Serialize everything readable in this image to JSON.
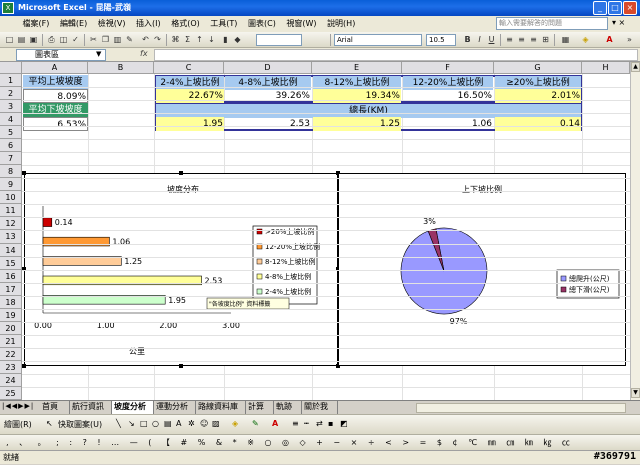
{
  "window": {
    "title": "Microsoft Excel - 昆陽-武嶺",
    "app_icon_label": "X",
    "min": "_",
    "max": "□",
    "close": "×"
  },
  "menu": {
    "items": [
      "檔案(F)",
      "編輯(E)",
      "檢視(V)",
      "插入(I)",
      "格式(O)",
      "工具(T)",
      "圖表(C)",
      "視窗(W)",
      "說明(H)"
    ],
    "help_placeholder": "輸入需要解答的問題"
  },
  "toolbar": {
    "font_name": "Arial",
    "font_size": "10.5",
    "zoom": ""
  },
  "formula": {
    "name_box": "圖表區",
    "fx": "fx",
    "value": ""
  },
  "columns": [
    "A",
    "B",
    "C",
    "D",
    "E",
    "F",
    "G",
    "H"
  ],
  "rows": [
    "1",
    "2",
    "3",
    "4",
    "5",
    "6",
    "7",
    "8",
    "9",
    "10",
    "11",
    "12",
    "13",
    "14",
    "15",
    "16",
    "17",
    "18",
    "19",
    "20",
    "21",
    "22",
    "23",
    "24",
    "25"
  ],
  "cells": {
    "a1": "平均上坡坡度",
    "a2": "8.09%",
    "a3": "平均下坡坡度",
    "a4": "6.53%",
    "c1": "2-4%上坡比例",
    "d1": "4-8%上坡比例",
    "e1": "8-12%上坡比例",
    "f1": "12-20%上坡比例",
    "g1": "≥20%上坡比例",
    "c2": "22.67%",
    "d2": "39.26%",
    "e2": "19.34%",
    "f2": "16.50%",
    "g2": "2.01%",
    "c3": "總長(KM)",
    "c4": "1.95",
    "d4": "2.53",
    "e4": "1.25",
    "f4": "1.06",
    "g4": "0.14"
  },
  "chart_data": [
    {
      "type": "bar",
      "title": "坡度分布",
      "xlabel": "公里",
      "categories": [
        "2-4%上坡比例",
        "4-8%上坡比例",
        "8-12%上坡比例",
        "12-20%上坡比例",
        ">20%上坡比例"
      ],
      "values": [
        1.95,
        2.53,
        1.25,
        1.06,
        0.14
      ],
      "value_labels": [
        "1.95",
        "2.53",
        "1.25",
        "1.06",
        "0.14"
      ],
      "colors": [
        "#ccffcc",
        "#ffff99",
        "#ffcc99",
        "#ff9933",
        "#cc0000"
      ],
      "xlim": [
        0,
        3
      ],
      "xticks": [
        "0.00",
        "1.00",
        "2.00",
        "3.00"
      ],
      "legend": [
        ">20%上坡比例",
        "12-20%上坡比例",
        "8-12%上坡比例",
        "4-8%上坡比例",
        "2-4%上坡比例"
      ],
      "legend_position": "right",
      "tooltip": "\"各坡度比例\" 資料標籤"
    },
    {
      "type": "pie",
      "title": "上下坡比例",
      "categories": [
        "總爬升(公尺)",
        "總下滑(公尺)"
      ],
      "values": [
        97,
        3
      ],
      "value_labels": [
        "97%",
        "3%"
      ],
      "colors": [
        "#9999ff",
        "#993366"
      ],
      "legend_position": "right"
    }
  ],
  "tabs": [
    "首頁",
    "航行資訊",
    "坡度分析",
    "運動分析",
    "路線資料庫",
    "計算",
    "軌跡",
    "關於我"
  ],
  "active_tab": "坡度分析",
  "drawbar": {
    "draw_label": "繪圖(R)",
    "autoshape_label": "快取圖案(U)"
  },
  "status": {
    "text": "就緒",
    "watermark": "#369791"
  }
}
